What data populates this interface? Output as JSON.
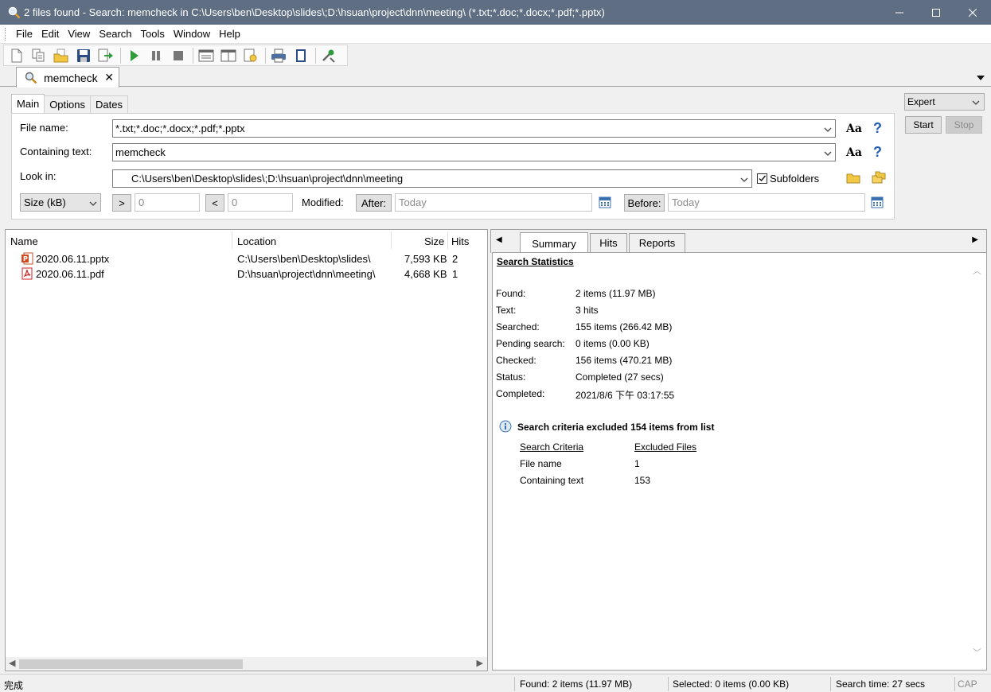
{
  "window": {
    "title": "2 files found - Search: memcheck in C:\\Users\\ben\\Desktop\\slides\\;D:\\hsuan\\project\\dnn\\meeting\\ (*.txt;*.doc;*.docx;*.pdf;*.pptx)"
  },
  "menu": [
    "File",
    "Edit",
    "View",
    "Search",
    "Tools",
    "Window",
    "Help"
  ],
  "doc_tab": {
    "label": "memcheck"
  },
  "criteria_tabs": [
    "Main",
    "Options",
    "Dates"
  ],
  "criteria": {
    "file_name_label": "File name:",
    "file_name_value": "*.txt;*.doc;*.docx;*.pdf;*.pptx",
    "containing_text_label": "Containing text:",
    "containing_text_value": "memcheck",
    "look_in_label": "Look in:",
    "look_in_value": "C:\\Users\\ben\\Desktop\\slides\\;D:\\hsuan\\project\\dnn\\meeting",
    "subfolders_label": "Subfolders",
    "subfolders_checked": true,
    "size_unit": "Size (kB)",
    "gt_label": ">",
    "gt_value": "0",
    "lt_label": "<",
    "lt_value": "0",
    "modified_label": "Modified:",
    "after_label": "After:",
    "after_value": "Today",
    "before_label": "Before:",
    "before_value": "Today",
    "aa_label": "Aa",
    "help_label": "?"
  },
  "right_controls": {
    "mode": "Expert",
    "start_label": "Start",
    "stop_label": "Stop"
  },
  "results": {
    "columns": {
      "name": "Name",
      "location": "Location",
      "size": "Size",
      "hits": "Hits"
    },
    "rows": [
      {
        "name": "2020.06.11.pptx",
        "location": "C:\\Users\\ben\\Desktop\\slides\\",
        "size": "7,593 KB",
        "hits": "2",
        "type": "pptx"
      },
      {
        "name": "2020.06.11.pdf",
        "location": "D:\\hsuan\\project\\dnn\\meeting\\",
        "size": "4,668 KB",
        "hits": "1",
        "type": "pdf"
      }
    ]
  },
  "summary_tabs": [
    "Summary",
    "Hits",
    "Reports"
  ],
  "summary": {
    "heading": "Search Statistics",
    "stats": [
      {
        "label": "Found:",
        "value": "2 items (11.97 MB)"
      },
      {
        "label": "Text:",
        "value": "3 hits"
      },
      {
        "label": "Searched:",
        "value": "155 items (266.42 MB)"
      },
      {
        "label": "Pending search:",
        "value": "0 items (0.00 KB)"
      },
      {
        "label": "Checked:",
        "value": "156 items (470.21 MB)"
      },
      {
        "label": "Status:",
        "value": "Completed (27 secs)"
      },
      {
        "label": "Completed:",
        "value": "2021/8/6 下午 03:17:55"
      }
    ],
    "excluded_heading": "Search criteria excluded 154 items from list",
    "excluded_cols": {
      "criteria": "Search Criteria",
      "files": "Excluded Files"
    },
    "excluded_rows": [
      {
        "criteria": "File name",
        "files": "1"
      },
      {
        "criteria": "Containing text",
        "files": "153"
      }
    ]
  },
  "statusbar": {
    "left": "完成",
    "found": "Found: 2 items (11.97 MB)",
    "selected": "Selected: 0 items (0.00 KB)",
    "time": "Search time: 27 secs",
    "caps": "CAP"
  },
  "colors": {
    "titlebar": "#5f6e82",
    "accent_blue": "#1f5fb5",
    "pdf_red": "#d02020",
    "pptx_orange": "#d04a20"
  }
}
